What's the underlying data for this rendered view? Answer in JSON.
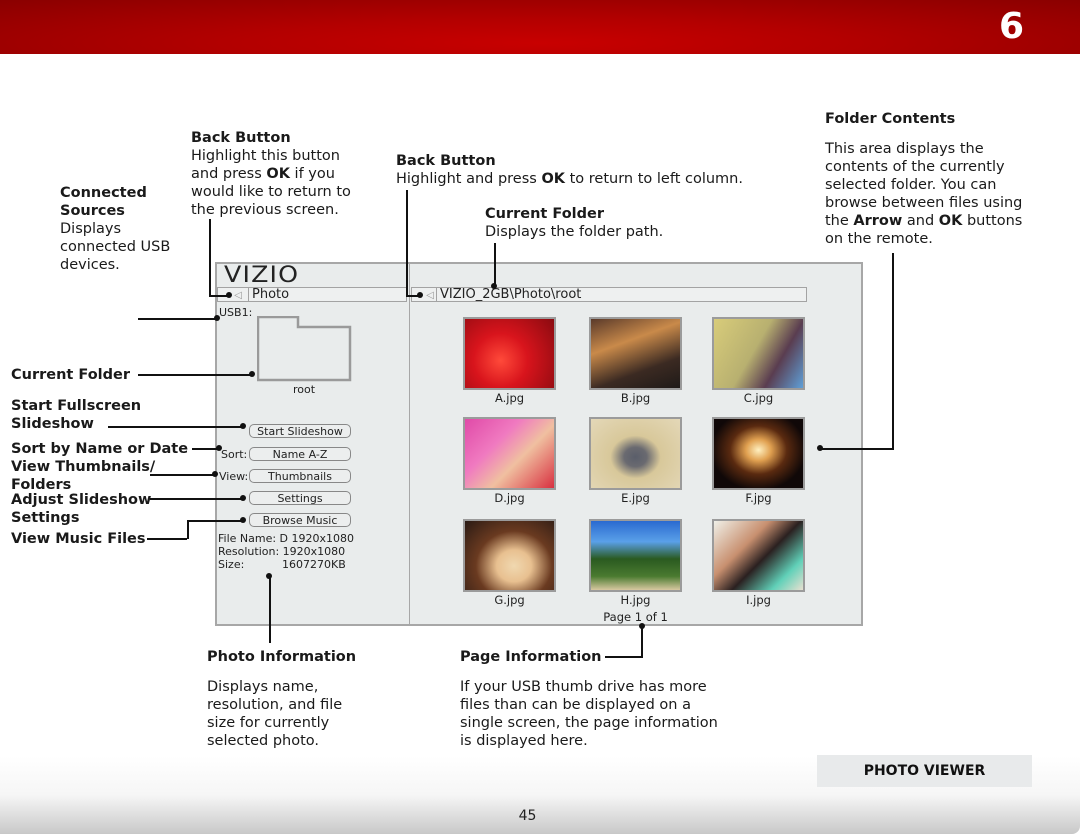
{
  "header": {
    "chapter_number": "6"
  },
  "annotations": {
    "back_button_left": {
      "title": "Back Button",
      "lines": [
        "Highlight this button",
        "and press ",
        "OK",
        " if you",
        "would like to return to",
        "the previous screen."
      ]
    },
    "connected_sources": {
      "title_1": "Connected",
      "title_2": "Sources",
      "desc": [
        "Displays",
        "connected USB",
        "devices."
      ]
    },
    "back_button_right": {
      "title": "Back Button",
      "desc_pre": "Highlight and press ",
      "desc_bold": "OK",
      "desc_post": " to return to left column."
    },
    "current_folder_top": {
      "title": "Current Folder",
      "desc": "Displays the folder path."
    },
    "folder_contents": {
      "title": "Folder Contents",
      "l1": "This area displays the",
      "l2": "contents of the currently",
      "l3": "selected folder. You can",
      "l4": "browse between files using",
      "l5_pre": "the ",
      "l5_b1": "Arrow",
      "l5_mid": " and ",
      "l5_b2": "OK",
      "l5_post": " buttons",
      "l6": "on the remote."
    },
    "left_labels": {
      "current_folder": "Current Folder",
      "start_fullscreen_1": "Start Fullscreen",
      "start_fullscreen_2": "Slideshow",
      "sort": "Sort by Name or Date",
      "view_1": "View Thumbnails/",
      "view_2": "Folders",
      "adjust_1": "Adjust Slideshow",
      "adjust_2": "Settings",
      "music": "View Music Files"
    },
    "photo_information": {
      "title": "Photo Information",
      "desc": [
        "Displays name,",
        "resolution, and file",
        "size for currently",
        "selected photo."
      ]
    },
    "page_information": {
      "title": "Page Information",
      "desc": [
        "If your USB thumb drive has more",
        "files than can be displayed on a",
        "single screen, the page information",
        "is displayed here."
      ]
    }
  },
  "screen": {
    "logo": "VIZIO",
    "left_path": "Photo",
    "source_label": "USB1:",
    "folder_name": "root",
    "start_slideshow": "Start Slideshow",
    "sort_label": "Sort:",
    "sort_value": "Name A-Z",
    "view_label": "View:",
    "view_value": "Thumbnails",
    "settings": "Settings",
    "browse_music": "Browse Music",
    "file_name": "File Name: D 1920x1080",
    "resolution": "Resolution: 1920x1080",
    "size_label": "Size:",
    "size_value": "1607270KB",
    "right_path": "VIZIO_2GB\\Photo\\root",
    "thumbnails": [
      {
        "name": "A.jpg",
        "subject": "strawberries"
      },
      {
        "name": "B.jpg",
        "subject": "steak meal"
      },
      {
        "name": "C.jpg",
        "subject": "woman with sunglasses"
      },
      {
        "name": "D.jpg",
        "subject": "two girls"
      },
      {
        "name": "E.jpg",
        "subject": "cat"
      },
      {
        "name": "F.jpg",
        "subject": "fireworks"
      },
      {
        "name": "G.jpg",
        "subject": "gratin dish"
      },
      {
        "name": "H.jpg",
        "subject": "palm trees"
      },
      {
        "name": "I.jpg",
        "subject": "couple selfie"
      }
    ],
    "page_info": "Page 1 of 1"
  },
  "footer": {
    "section": "PHOTO VIEWER",
    "page_number": "45"
  },
  "colors": {
    "header_red": "#c80000",
    "panel_bg": "#e9ecec",
    "panel_border": "#a7a7a7"
  }
}
